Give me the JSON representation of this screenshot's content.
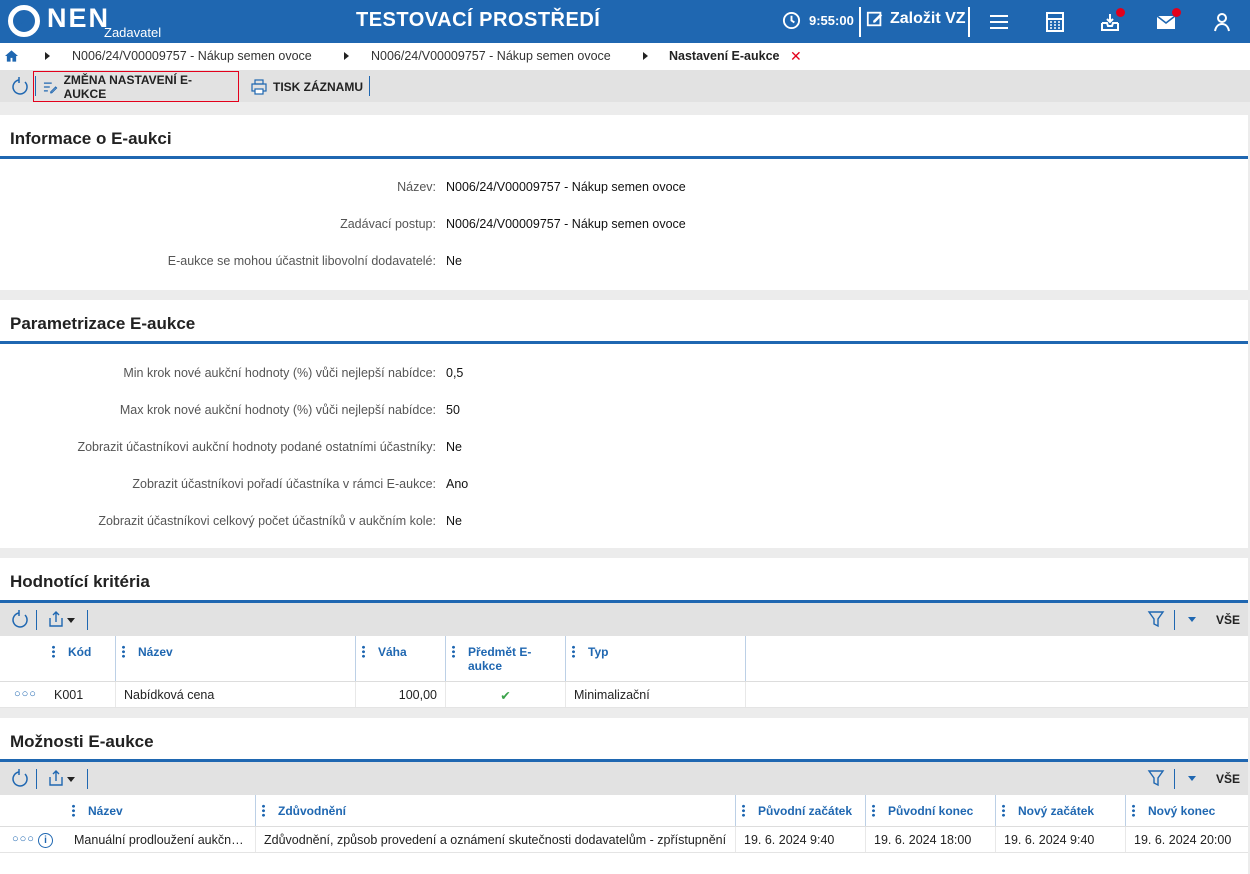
{
  "header": {
    "logo": "NEN",
    "logo_sub": "Zadavatel",
    "env_title": "TESTOVACÍ PROSTŘEDÍ",
    "time": "9:55:00",
    "new_vz": "Založit VZ"
  },
  "breadcrumb": {
    "items": [
      "N006/24/V00009757 - Nákup semen ovoce",
      "N006/24/V00009757 - Nákup semen ovoce",
      "Nastavení E-aukce"
    ]
  },
  "toolbar": {
    "change_label": "ZMĚNA NASTAVENÍ E-AUKCE",
    "print_label": "TISK ZÁZNAMU"
  },
  "info": {
    "title": "Informace o E-aukci",
    "fields": [
      {
        "label": "Název:",
        "value": "N006/24/V00009757 - Nákup semen ovoce"
      },
      {
        "label": "Zadávací postup:",
        "value": "N006/24/V00009757 - Nákup semen ovoce"
      },
      {
        "label": "E-aukce se mohou účastnit libovolní dodavatelé:",
        "value": "Ne"
      }
    ]
  },
  "params": {
    "title": "Parametrizace E-aukce",
    "fields": [
      {
        "label": "Min krok nové aukční hodnoty (%) vůči nejlepší nabídce:",
        "value": "0,5"
      },
      {
        "label": "Max krok nové aukční hodnoty (%) vůči nejlepší nabídce:",
        "value": "50"
      },
      {
        "label": "Zobrazit účastníkovi aukční hodnoty podané ostatními účastníky:",
        "value": "Ne"
      },
      {
        "label": "Zobrazit účastníkovi pořadí účastníka v rámci E-aukce:",
        "value": "Ano"
      },
      {
        "label": "Zobrazit účastníkovi celkový počet účastníků v aukčním kole:",
        "value": "Ne"
      }
    ]
  },
  "criteria": {
    "title": "Hodnotící kritéria",
    "all_label": "VŠE",
    "columns": [
      "Kód",
      "Název",
      "Váha",
      "Předmět E-aukce",
      "Typ"
    ],
    "rows": [
      {
        "kod": "K001",
        "nazev": "Nabídková cena",
        "vaha": "100,00",
        "predmet": "✔",
        "typ": "Minimalizační"
      }
    ]
  },
  "options": {
    "title": "Možnosti E-aukce",
    "all_label": "VŠE",
    "columns": [
      "Název",
      "Zdůvodnění",
      "Původní začátek",
      "Původní konec",
      "Nový začátek",
      "Nový konec"
    ],
    "rows": [
      {
        "nazev": "Manuální prodloužení aukčního kola",
        "zduvodneni": "Zdůvodnění, způsob provedení a oznámení skutečnosti dodavatelům - zpřístupnění",
        "puv_zacatek": "19. 6. 2024 9:40",
        "puv_konec": "19. 6. 2024 18:00",
        "novy_zacatek": "19. 6. 2024 9:40",
        "novy_konec": "19. 6. 2024 20:00"
      }
    ]
  },
  "colors": {
    "brand": "#1f67b1",
    "alert": "#e3001b",
    "check": "#3aa34a"
  }
}
